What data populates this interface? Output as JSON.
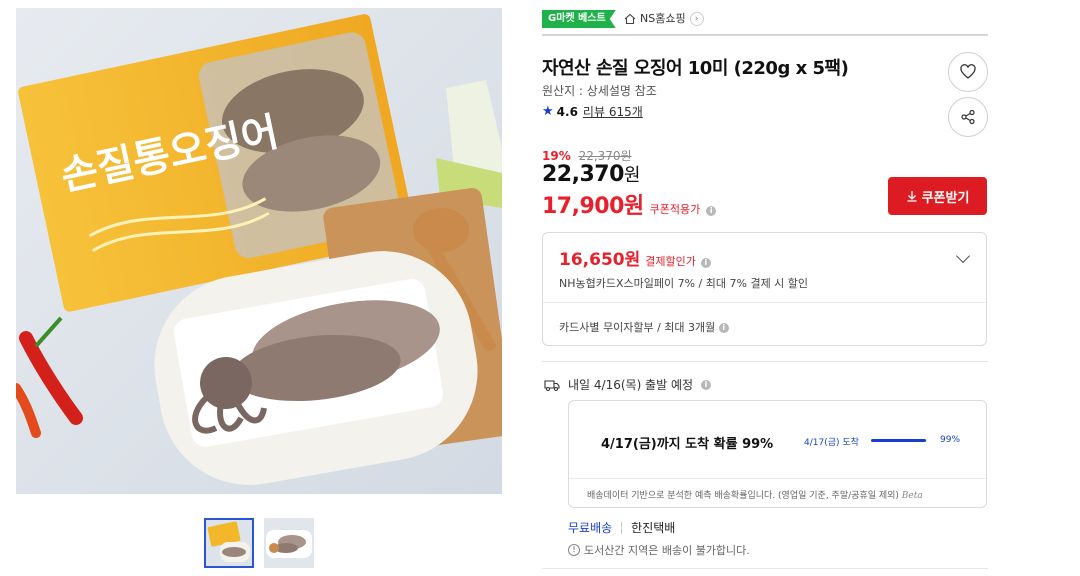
{
  "badges": {
    "gmarket_best": "G마켓 베스트"
  },
  "shop": {
    "name": "NS홈쇼핑",
    "icon": "home-icon"
  },
  "product": {
    "title": "자연산 손질 오징어 10미 (220g x 5팩)",
    "origin": "원산지 : 상세설명 참조",
    "rating": "4.6",
    "review_text": "리뷰 615개",
    "package_text": "손질통오징어"
  },
  "price": {
    "discount_pct": "19%",
    "original": "22,370원",
    "sale_amount": "22,370",
    "sale_unit": "원",
    "coupon_price": "17,900원",
    "coupon_label": "쿠폰적용가",
    "coupon_button": "쿠폰받기"
  },
  "payment": {
    "price": "16,650원",
    "label": "결제할인가",
    "desc": "NH농협카드X스마일페이 7% / 최대 7% 결제 시 할인",
    "installment": "카드사별 무이자할부 / 최대 3개월"
  },
  "shipping": {
    "departure": "내일 4/16(목) 출발 예정",
    "headline": "4/17(금)까지 도착 확률 99%",
    "bar_label": "4/17(금) 도착",
    "bar_pct": "99%",
    "bar_value": 0.99,
    "note": "배송데이터 기반으로 분석한 예측 배송확률입니다. (영업일 기준, 주말/공휴일 제외)",
    "beta": "Beta",
    "free": "무료배송",
    "carrier": "한진택배",
    "notice": "도서산간 지역은 배송이 불가합니다."
  },
  "colors": {
    "accent_red": "#dc1c22",
    "accent_blue": "#1a3fd0",
    "badge_green": "#1fb24b",
    "package_yellow": "#f3b829"
  }
}
